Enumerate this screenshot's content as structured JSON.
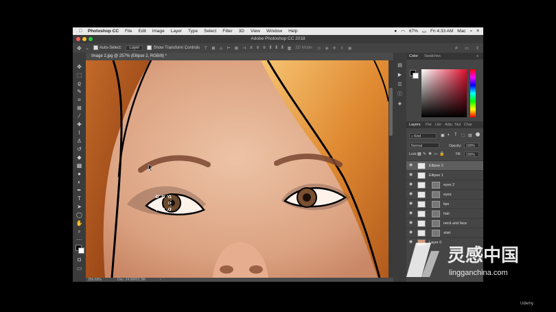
{
  "menubar": {
    "apple": "",
    "app": "Photoshop CC",
    "items": [
      "File",
      "Edit",
      "Image",
      "Layer",
      "Type",
      "Select",
      "Filter",
      "3D",
      "View",
      "Window",
      "Help"
    ],
    "battery": "67%",
    "time": "Fri 4:33 AM",
    "user": "Mac"
  },
  "window": {
    "title": "Adobe Photoshop CC 2018"
  },
  "options": {
    "auto_select": "Auto-Select:",
    "auto_select_value": "Layer",
    "transform": "Show Transform Controls",
    "mode_3d": "3D Mode:"
  },
  "document": {
    "tab": "Image 2.jpg @ 257% (Ellipse 2, RGB/8) *",
    "zoom": "256.69%",
    "doc_size": "Doc: 24.0M/52.3M"
  },
  "color_panel": {
    "tabs": [
      "Color",
      "Swatches"
    ],
    "foreground": "#000000",
    "background": "#ffffff"
  },
  "layers_panel": {
    "tabs": [
      "Layers",
      "Pat",
      "Libr",
      "Adju",
      "Styl",
      "Char"
    ],
    "filter": "Kind",
    "blend_mode": "Normal",
    "opacity_label": "Opacity:",
    "opacity": "100%",
    "lock_label": "Lock:",
    "fill_label": "Fill:",
    "fill": "100%",
    "layers": [
      {
        "name": "Ellipse 2",
        "selected": true,
        "mask": false
      },
      {
        "name": "Ellipse 1",
        "selected": false,
        "mask": false
      },
      {
        "name": "eyes 2",
        "selected": false,
        "mask": true
      },
      {
        "name": "eyes",
        "selected": false,
        "mask": true
      },
      {
        "name": "lips",
        "selected": false,
        "mask": true
      },
      {
        "name": "hair",
        "selected": false,
        "mask": true
      },
      {
        "name": "neck and face",
        "selected": false,
        "mask": true
      },
      {
        "name": "shirt",
        "selected": false,
        "mask": true
      },
      {
        "name": "Layer 0",
        "selected": false,
        "mask": false
      }
    ]
  },
  "watermark": {
    "cn": "灵感中国",
    "url": "lingganchina.com"
  },
  "udemy": "Udemy"
}
